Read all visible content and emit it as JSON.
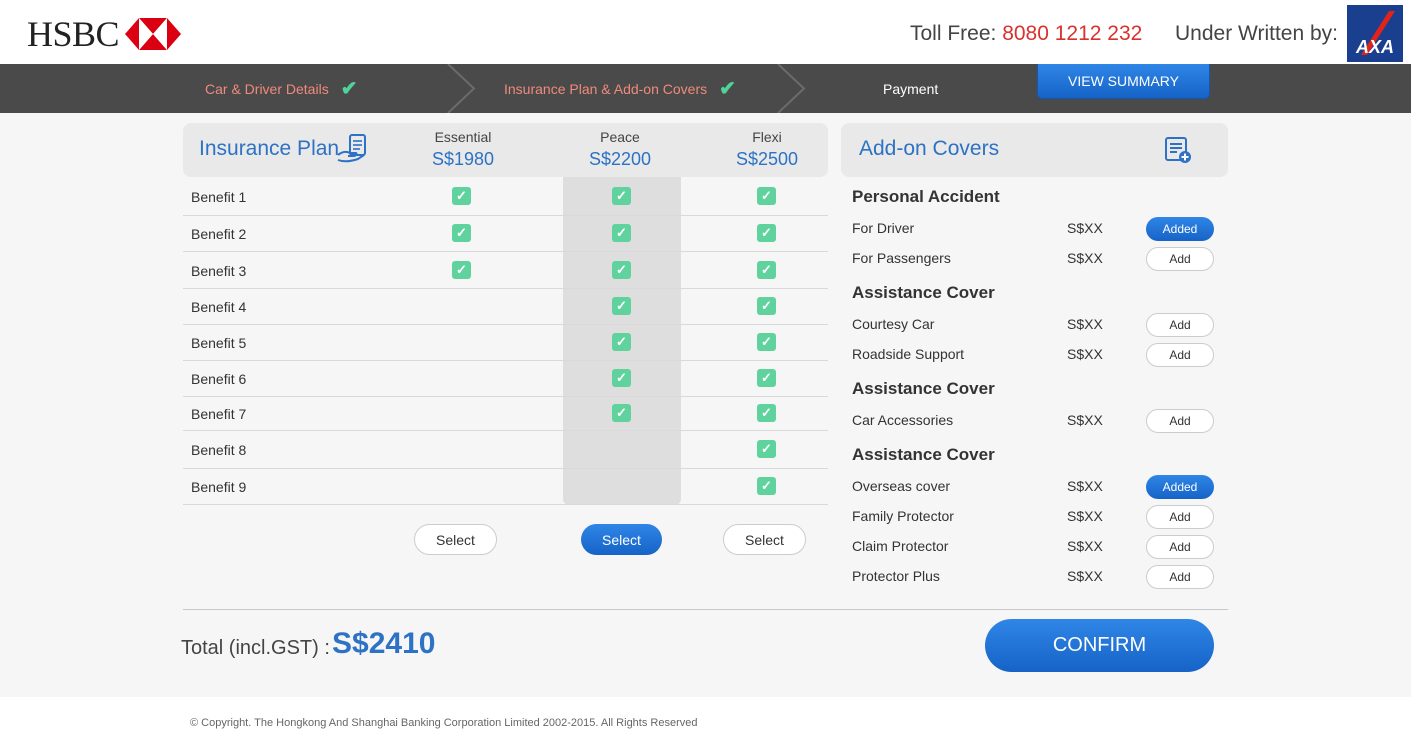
{
  "header": {
    "logo_text": "HSBC",
    "toll_free_label": "Toll Free:",
    "toll_free_number": "8080 1212 232",
    "underwritten_label": "Under Written by:",
    "underwriter_logo_text": "AXA"
  },
  "steps": [
    {
      "label": "Car & Driver Details",
      "done": true
    },
    {
      "label": "Insurance Plan & Add-on Covers",
      "done": true
    },
    {
      "label": "Payment",
      "done": false
    }
  ],
  "view_summary_label": "VIEW SUMMARY",
  "plan": {
    "title": "Insurance Plan",
    "columns": [
      {
        "name": "Essential",
        "price": "S$1980"
      },
      {
        "name": "Peace",
        "price": "S$2200"
      },
      {
        "name": "Flexi",
        "price": "S$2500"
      }
    ],
    "benefits": [
      {
        "label": "Benefit 1",
        "essential": true,
        "peace": true,
        "flexi": true
      },
      {
        "label": "Benefit 2",
        "essential": true,
        "peace": true,
        "flexi": true
      },
      {
        "label": "Benefit 3",
        "essential": true,
        "peace": true,
        "flexi": true
      },
      {
        "label": "Benefit 4",
        "essential": false,
        "peace": true,
        "flexi": true
      },
      {
        "label": "Benefit 5",
        "essential": false,
        "peace": true,
        "flexi": true
      },
      {
        "label": "Benefit 6",
        "essential": false,
        "peace": true,
        "flexi": true
      },
      {
        "label": "Benefit 7",
        "essential": false,
        "peace": true,
        "flexi": true
      },
      {
        "label": "Benefit 8",
        "essential": false,
        "peace": false,
        "flexi": true
      },
      {
        "label": "Benefit 9",
        "essential": false,
        "peace": false,
        "flexi": true
      }
    ],
    "select_label": "Select",
    "selected_plan": "Peace"
  },
  "addons": {
    "title": "Add-on Covers",
    "sections": [
      {
        "title": "Personal Accident",
        "items": [
          {
            "label": "For Driver",
            "price": "S$XX",
            "button": "Added"
          },
          {
            "label": "For Passengers",
            "price": "S$XX",
            "button": "Add"
          }
        ]
      },
      {
        "title": "Assistance Cover",
        "items": [
          {
            "label": "Courtesy Car",
            "price": "S$XX",
            "button": "Add"
          },
          {
            "label": "Roadside Support",
            "price": "S$XX",
            "button": "Add"
          }
        ]
      },
      {
        "title": "Assistance Cover",
        "items": [
          {
            "label": "Car Accessories",
            "price": "S$XX",
            "button": "Add"
          }
        ]
      },
      {
        "title": "Assistance Cover",
        "items": [
          {
            "label": "Overseas cover",
            "price": "S$XX",
            "button": "Added"
          },
          {
            "label": "Family Protector",
            "price": "S$XX",
            "button": "Add"
          },
          {
            "label": "Claim Protector",
            "price": "S$XX",
            "button": "Add"
          },
          {
            "label": "Protector Plus",
            "price": "S$XX",
            "button": "Add"
          }
        ]
      }
    ]
  },
  "total": {
    "label": "Total (incl.GST) :",
    "value": "S$2410"
  },
  "confirm_label": "CONFIRM",
  "copyright": "© Copyright. The Hongkong And Shanghai Banking Corporation Limited 2002-2015. All Rights Reserved",
  "colors": {
    "accent_blue": "#2d72c4",
    "toll_red": "#d9322e",
    "check_green": "#5fd29e",
    "step_done": "#f08a7c"
  }
}
